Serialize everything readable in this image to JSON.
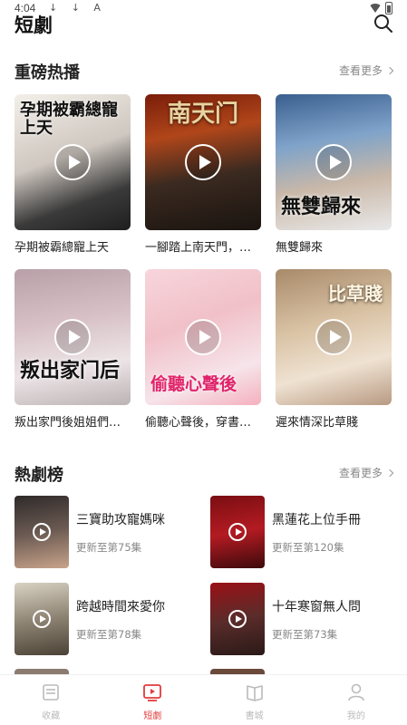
{
  "status_bar": {
    "time": "4:04",
    "notifications": "↓ ↓ A"
  },
  "header": {
    "title": "短劇",
    "search_icon": "search-icon"
  },
  "hot_section": {
    "title": "重磅热播",
    "more_label": "查看更多",
    "items": [
      {
        "name": "孕期被霸總寵上天",
        "poster_text": "孕期被霸總寵上天"
      },
      {
        "name": "一腳踏上南天門，…",
        "poster_text": "南天门"
      },
      {
        "name": "無雙歸來",
        "poster_text": "無雙歸來"
      },
      {
        "name": "叛出家門後姐姐們…",
        "poster_text": "叛出家门后"
      },
      {
        "name": "偷聽心聲後，穿書…",
        "poster_text": "偷聽心聲後"
      },
      {
        "name": "遲來情深比草賤",
        "poster_text": "比草賤"
      }
    ]
  },
  "rank_section": {
    "title": "熱劇榜",
    "more_label": "查看更多",
    "items": [
      {
        "title": "三寶助攻寵媽咪",
        "update": "更新至第75集"
      },
      {
        "title": "黑蓮花上位手冊",
        "update": "更新至第120集"
      },
      {
        "title": "跨越時間來愛你",
        "update": "更新至第78集"
      },
      {
        "title": "十年寒窗無人問",
        "update": "更新至第73集"
      }
    ]
  },
  "tabbar": {
    "tabs": [
      {
        "label": "收藏",
        "icon": "bookshelf-icon",
        "active": false
      },
      {
        "label": "短劇",
        "icon": "video-play-icon",
        "active": true
      },
      {
        "label": "書城",
        "icon": "book-icon",
        "active": false
      },
      {
        "label": "我的",
        "icon": "person-icon",
        "active": false
      }
    ]
  },
  "colors": {
    "accent": "#e23b3b",
    "muted": "#bbbbbb",
    "secondary_text": "#888888"
  }
}
